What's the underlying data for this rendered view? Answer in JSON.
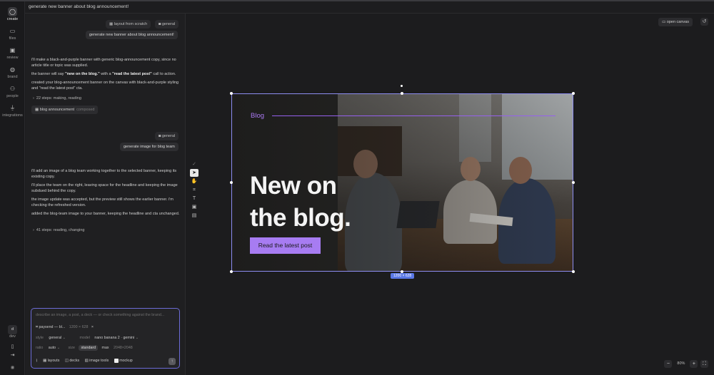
{
  "topbar": {
    "title": "generate new banner about blog announcement!"
  },
  "rail": {
    "items": [
      {
        "label": "create",
        "icon": "chat-bubble-icon"
      },
      {
        "label": "files",
        "icon": "folder-icon"
      },
      {
        "label": "review",
        "icon": "clipboard-icon"
      },
      {
        "label": "brand",
        "icon": "palette-icon"
      },
      {
        "label": "people",
        "icon": "people-icon"
      },
      {
        "label": "integrations",
        "icon": "plug-icon"
      }
    ],
    "workspace_label": "dev",
    "workspace_letter": "d"
  },
  "chat": {
    "tags1": [
      "layout from scratch",
      "general"
    ],
    "user1": "generate new banner about blog announcement!",
    "assistant1": {
      "p1": "i'll make a black-and-purple banner with generic blog-announcement copy, since no article title or topic was supplied.",
      "p2_a": "the banner will say ",
      "p2_b": "\"new on the blog.\"",
      "p2_c": " with a ",
      "p2_d": "\"read the latest post\"",
      "p2_e": " call to action.",
      "p3": "created your blog-announcement banner on the canvas with black-and-purple styling and \"read the latest post\" cta.",
      "steps": "22 steps: making, reading",
      "chip": "blog announcement",
      "chip_sub": "composed"
    },
    "tags2": [
      "general"
    ],
    "user2": "generate image for blog team",
    "assistant2": {
      "p1": "i'll add an image of a blog team working together to the selected banner, keeping its existing copy.",
      "p2": "i'll place the team on the right, leaving space for the headline and keeping the image subdued behind the copy.",
      "p3": "the image update was accepted, but the preview still shows the earlier banner. i'm checking the refreshed version.",
      "p4": "added the blog-team image to your banner, keeping the headline and cta unchanged.",
      "steps": "41 steps: reading, changing"
    }
  },
  "composer": {
    "placeholder": "describe an image, a post, a deck — or check something against the brand...",
    "attachment": "paysend — bl...",
    "attachment_size": "1200 × 628",
    "style_label": "style",
    "style_value": "general",
    "model_label": "model",
    "model_value": "nano banana 2 · gemini",
    "ratio_label": "ratio",
    "ratio_value": "auto",
    "size_label": "size",
    "size_value": "standard",
    "max_label": "max",
    "max_value": "2048×2048",
    "actions": [
      "layouts",
      "decks",
      "image tools",
      "mockup"
    ]
  },
  "canvas": {
    "open_canvas": "open canvas",
    "dimensions": "1200 × 628",
    "zoom": "80%"
  },
  "banner": {
    "tag": "Blog",
    "headline_line1": "New on",
    "headline_line2": "the blog.",
    "cta": "Read the latest post"
  },
  "colors": {
    "accent": "#a77cf2",
    "selection": "#8d8df0",
    "background": "#1c1c1e"
  }
}
